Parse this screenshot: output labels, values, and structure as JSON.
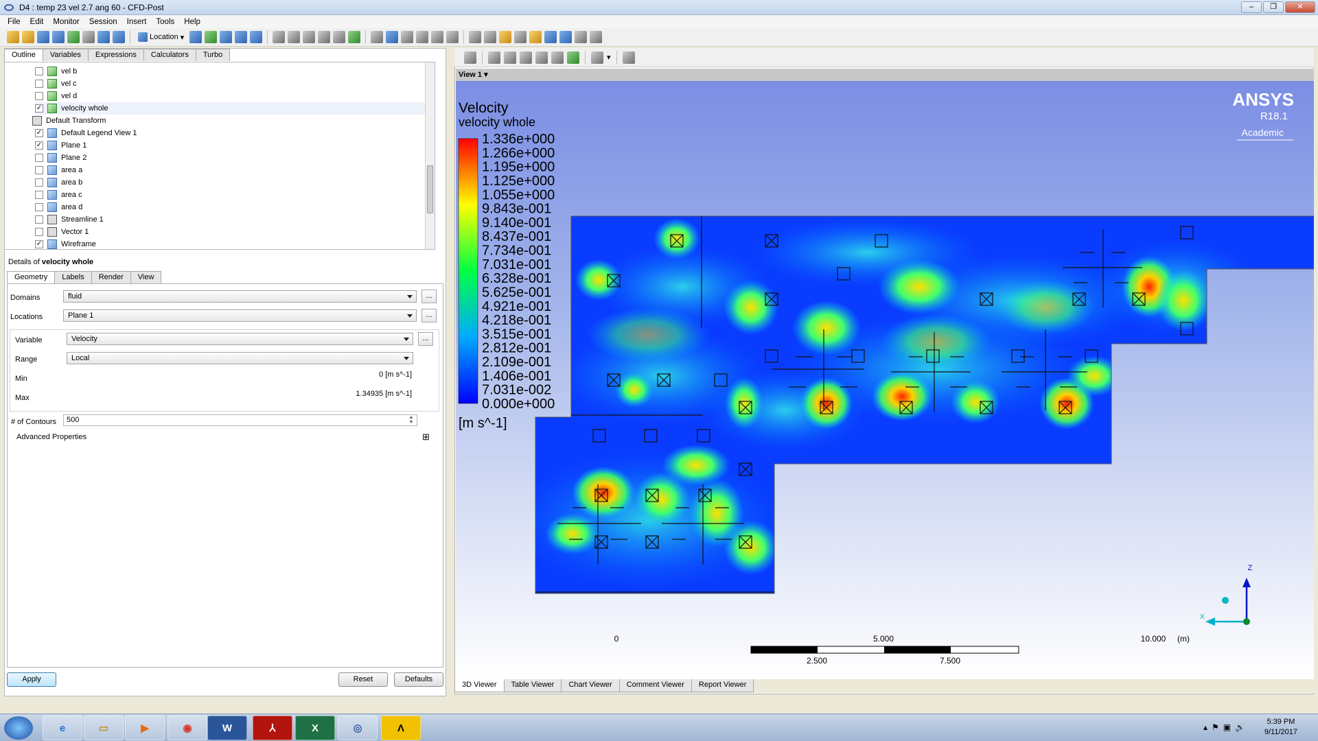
{
  "window": {
    "title": "D4 : temp 23 vel 2.7 ang 60 - CFD-Post"
  },
  "menu": [
    "File",
    "Edit",
    "Monitor",
    "Session",
    "Insert",
    "Tools",
    "Help"
  ],
  "toolbar": {
    "location_label": "Location"
  },
  "left_tabs": [
    "Outline",
    "Variables",
    "Expressions",
    "Calculators",
    "Turbo"
  ],
  "tree": [
    {
      "label": "vel b",
      "checked": false,
      "icon": "contour-icon"
    },
    {
      "label": "vel c",
      "checked": false,
      "icon": "contour-icon"
    },
    {
      "label": "vel d",
      "checked": false,
      "icon": "contour-icon"
    },
    {
      "label": "velocity whole",
      "checked": true,
      "icon": "contour-icon"
    },
    {
      "label": "Default Transform",
      "checked": null,
      "icon": "transform-icon"
    },
    {
      "label": "Default Legend View 1",
      "checked": true,
      "icon": "legend-icon"
    },
    {
      "label": "Plane 1",
      "checked": true,
      "icon": "plane-icon"
    },
    {
      "label": "Plane 2",
      "checked": false,
      "icon": "plane-icon"
    },
    {
      "label": "area a",
      "checked": false,
      "icon": "plane-icon"
    },
    {
      "label": "area b",
      "checked": false,
      "icon": "plane-icon"
    },
    {
      "label": "area c",
      "checked": false,
      "icon": "plane-icon"
    },
    {
      "label": "area d",
      "checked": false,
      "icon": "plane-icon"
    },
    {
      "label": "Streamline 1",
      "checked": false,
      "icon": "streamline-icon"
    },
    {
      "label": "Vector 1",
      "checked": false,
      "icon": "vector-icon"
    },
    {
      "label": "Wireframe",
      "checked": true,
      "icon": "wireframe-icon"
    }
  ],
  "details": {
    "prefix": "Details of",
    "name": "velocity whole",
    "tabs": [
      "Geometry",
      "Labels",
      "Render",
      "View"
    ],
    "domains_label": "Domains",
    "domains_value": "fluid",
    "locations_label": "Locations",
    "locations_value": "Plane 1",
    "variable_label": "Variable",
    "variable_value": "Velocity",
    "range_label": "Range",
    "range_value": "Local",
    "min_label": "Min",
    "min_value": "0 [m s^-1]",
    "max_label": "Max",
    "max_value": "1.34935 [m s^-1]",
    "contours_label": "# of Contours",
    "contours_value": "500",
    "advanced_label": "Advanced Properties",
    "ellipsis": "...",
    "expand": "⊞"
  },
  "buttons": {
    "apply": "Apply",
    "reset": "Reset",
    "defaults": "Defaults"
  },
  "viewer": {
    "view_label": "View 1",
    "legend_title": "Velocity",
    "legend_subtitle": "velocity whole",
    "legend_values": [
      "1.336e+000",
      "1.266e+000",
      "1.195e+000",
      "1.125e+000",
      "1.055e+000",
      "9.843e-001",
      "9.140e-001",
      "8.437e-001",
      "7.734e-001",
      "7.031e-001",
      "6.328e-001",
      "5.625e-001",
      "4.921e-001",
      "4.218e-001",
      "3.515e-001",
      "2.812e-001",
      "2.109e-001",
      "1.406e-001",
      "7.031e-002",
      "0.000e+000"
    ],
    "legend_unit": "[m s^-1]",
    "brand": "ANSYS",
    "version": "R18.1",
    "edition": "Academic",
    "scale_top": [
      "0",
      "5.000",
      "10.000",
      "(m)"
    ],
    "scale_bottom": [
      "2.500",
      "7.500"
    ],
    "axis_z": "Z",
    "axis_x": "X",
    "colors": {
      "low": "#0000ff",
      "high": "#ff0000",
      "background_top": "#7b8ee4"
    }
  },
  "bottom_tabs": [
    "3D Viewer",
    "Table Viewer",
    "Chart Viewer",
    "Comment Viewer",
    "Report Viewer"
  ],
  "taskbar": {
    "time": "5:39 PM",
    "date": "9/11/2017"
  }
}
